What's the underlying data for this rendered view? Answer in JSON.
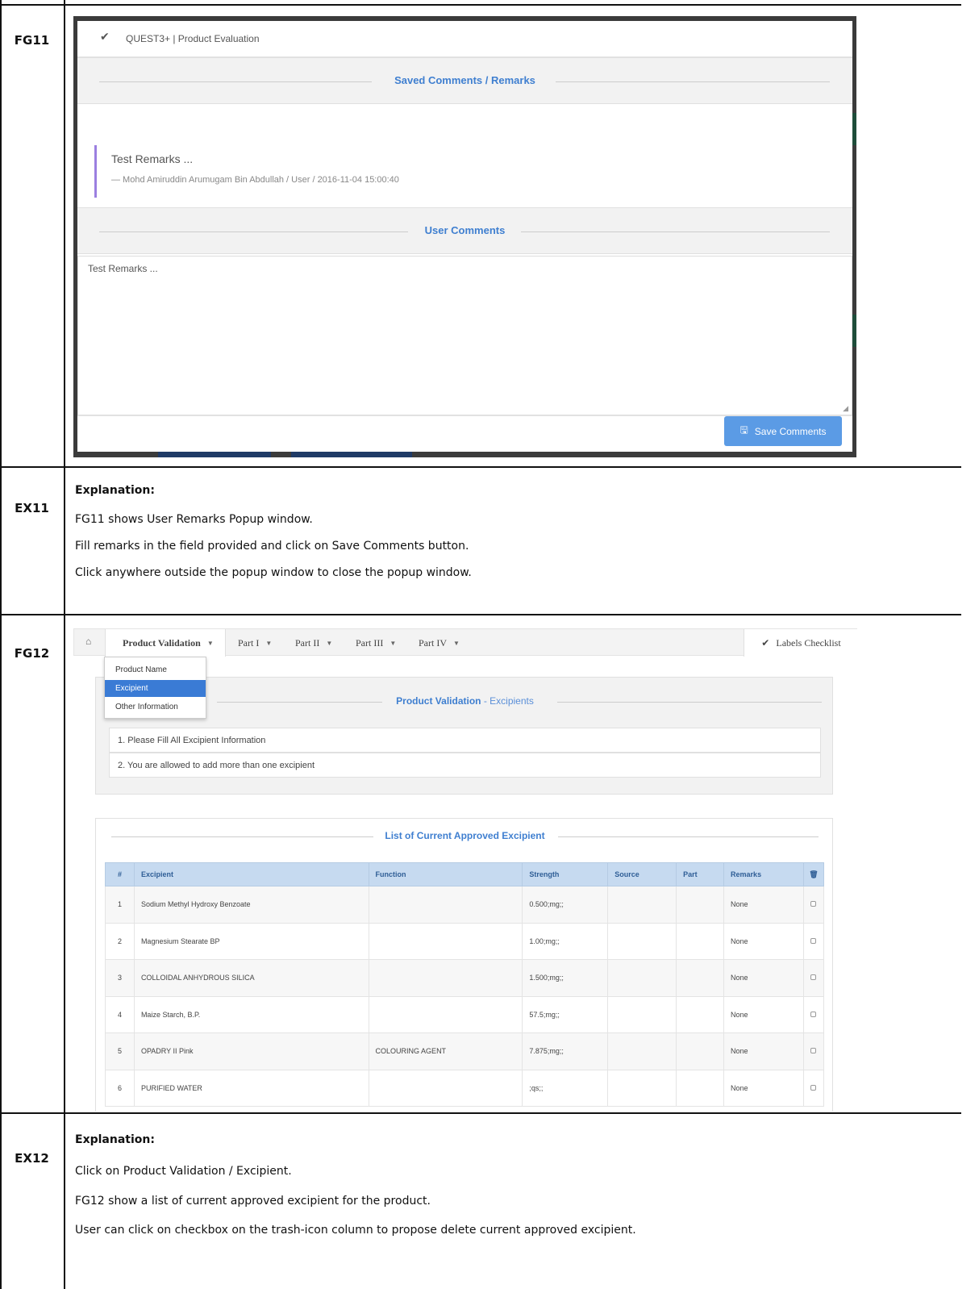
{
  "rows": {
    "fg11": "FG11",
    "ex11": "EX11",
    "fg12": "FG12",
    "ex12": "EX12"
  },
  "popup": {
    "title": "QUEST3+ | Product Evaluation",
    "saved_heading": "Saved Comments / Remarks",
    "remark_text": "Test Remarks ...",
    "remark_meta": "— Mohd Amiruddin Arumugam Bin Abdullah / User / 2016-11-04 15:00:40",
    "user_heading": "User Comments",
    "comment_value": "Test Remarks ...",
    "save_label": "Save Comments"
  },
  "ex11": {
    "heading": "Explanation:",
    "lines": [
      "FG11 shows User Remarks Popup window.",
      "Fill remarks in the field provided and click on Save Comments button.",
      "Click anywhere outside the popup window to close the popup window."
    ]
  },
  "fg12": {
    "tabs": [
      "Product Validation",
      "Part I",
      "Part II",
      "Part III",
      "Part IV"
    ],
    "labels_checklist": "Labels Checklist",
    "dropdown": [
      "Product Name",
      "Excipient",
      "Other Information"
    ],
    "dropdown_selected": "Excipient",
    "panel_title_main": "Product Validation",
    "panel_title_sub": " - Excipients",
    "notes": [
      "1. Please Fill All Excipient Information",
      "2. You are allowed to add more than one excipient"
    ],
    "list_title": "List of Current Approved Excipient",
    "columns": [
      "#",
      "Excipient",
      "Function",
      "Strength",
      "Source",
      "Part",
      "Remarks"
    ],
    "rows": [
      {
        "no": "1",
        "excipient": "Sodium Methyl Hydroxy Benzoate",
        "function": "",
        "strength": "0.500;mg;;",
        "source": "",
        "part": "",
        "remarks": "None"
      },
      {
        "no": "2",
        "excipient": "Magnesium Stearate BP",
        "function": "",
        "strength": "1.00;mg;;",
        "source": "",
        "part": "",
        "remarks": "None"
      },
      {
        "no": "3",
        "excipient": "COLLOIDAL ANHYDROUS SILICA",
        "function": "",
        "strength": "1.500;mg;;",
        "source": "",
        "part": "",
        "remarks": "None"
      },
      {
        "no": "4",
        "excipient": "Maize Starch, B.P.",
        "function": "",
        "strength": "57.5;mg;;",
        "source": "",
        "part": "",
        "remarks": "None"
      },
      {
        "no": "5",
        "excipient": "OPADRY II Pink",
        "function": "COLOURING AGENT",
        "strength": "7.875;mg;;",
        "source": "",
        "part": "",
        "remarks": "None"
      },
      {
        "no": "6",
        "excipient": "PURIFIED WATER",
        "function": "",
        "strength": ";qs;;",
        "source": "",
        "part": "",
        "remarks": "None"
      }
    ]
  },
  "ex12": {
    "heading": "Explanation:",
    "lines": [
      "Click on Product Validation / Excipient.",
      "FG12 show a list of current approved excipient for the product.",
      "User can click on checkbox on the trash-icon column to propose delete current approved excipient."
    ]
  }
}
